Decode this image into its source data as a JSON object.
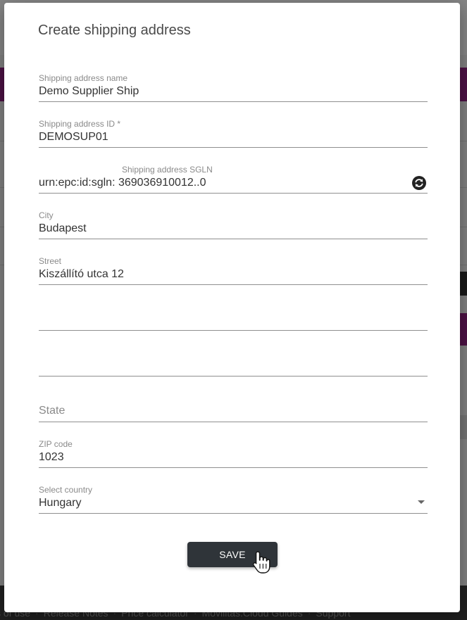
{
  "background": {
    "footer_links": [
      "s of use",
      "Release Notes",
      "Price calculator",
      "Movilitas.Cloud Guides",
      "Support"
    ]
  },
  "dialog": {
    "title": "Create shipping address",
    "fields": {
      "name": {
        "label": "Shipping address name",
        "value": "Demo Supplier Ship"
      },
      "id": {
        "label": "Shipping address ID *",
        "value": "DEMOSUP01"
      },
      "sgln": {
        "label": "Shipping address SGLN",
        "value": "urn:epc:id:sgln: 369036910012..0"
      },
      "city": {
        "label": "City",
        "value": "Budapest"
      },
      "street": {
        "label": "Street",
        "value": "Kiszállító utca 12"
      },
      "address_line_2": {
        "value": ""
      },
      "address_line_3": {
        "value": ""
      },
      "state": {
        "placeholder": "State"
      },
      "zip": {
        "label": "ZIP code",
        "value": "1023"
      },
      "country": {
        "label": "Select country",
        "value": "Hungary"
      }
    },
    "save_label": "SAVE"
  },
  "icons": {
    "sgln_refresh": "refresh-icon",
    "country_dropdown": "chevron-down-icon",
    "cursor": "hand-pointer-cursor"
  },
  "colors": {
    "button_bg": "#2f3439",
    "brand_purple": "#8a1f7c",
    "underline": "#8f8f8f",
    "label": "#8a8a8a",
    "text": "#333333"
  }
}
